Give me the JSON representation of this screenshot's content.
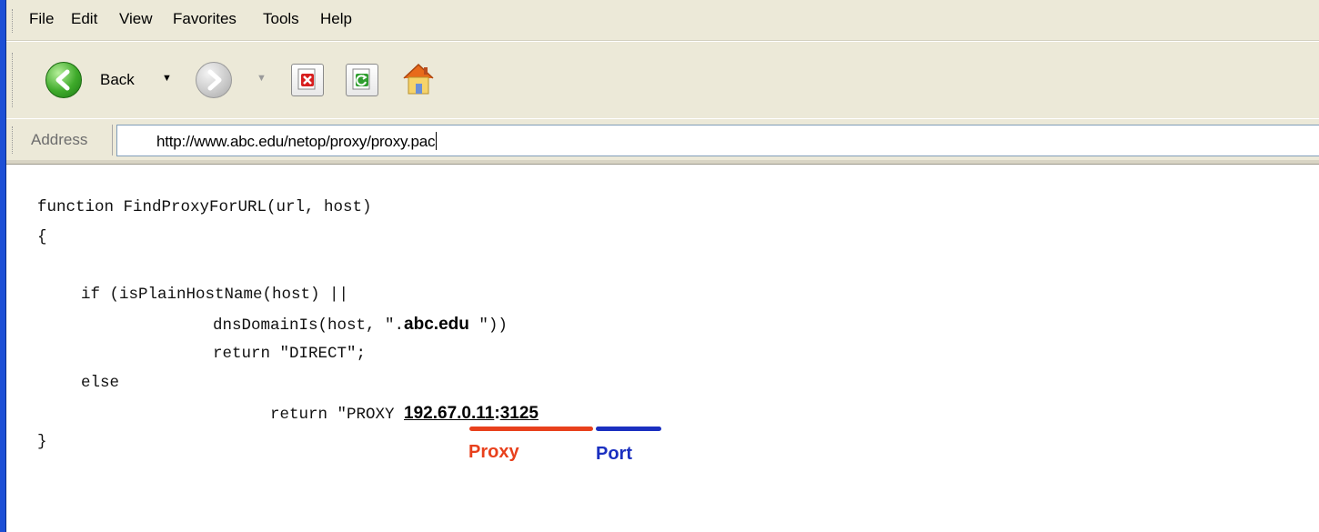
{
  "menu": [
    "File",
    "Edit",
    "View",
    "Favorites",
    "Tools",
    "Help"
  ],
  "toolbar": {
    "back_label": "Back",
    "icons": [
      "back-arrow-icon",
      "forward-arrow-icon",
      "stop-icon",
      "refresh-icon",
      "home-icon"
    ]
  },
  "address": {
    "label": "Address",
    "value": "http://www.abc.edu/netop/proxy/proxy.pac"
  },
  "code": {
    "line1": "function FindProxyForURL(url, host)",
    "line2": "{",
    "line3": "if (isPlainHostName(host) ||",
    "line4_pre": "dnsDomainIs(host, \".",
    "line4_domain": "abc.edu",
    "line4_post": " \"))",
    "line5": "return \"DIRECT\";",
    "line6": "else",
    "line7_pre": "return \"PROXY ",
    "proxy_ip": "192.67.0.11",
    "colon": ":",
    "port": "3125",
    "line8": "}"
  },
  "annotations": {
    "proxy_label": "Proxy",
    "port_label": "Port",
    "proxy_color": "#e8401c",
    "port_color": "#1a2fc0"
  }
}
